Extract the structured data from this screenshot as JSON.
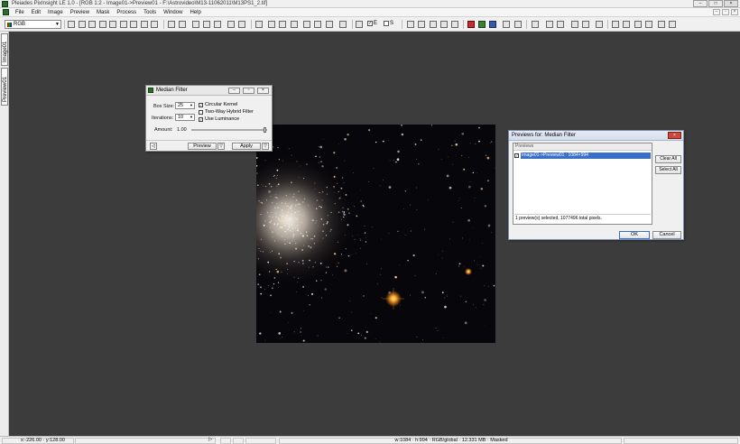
{
  "window": {
    "title": "Pleiades PixInsight LE 1.0 - [RGB 1:2 - Image01->Preview01 - F:\\Astrovideo\\M13-11062011\\M13PS1_2.tif]"
  },
  "menu": [
    "File",
    "Edit",
    "Image",
    "Preview",
    "Mask",
    "Process",
    "Tools",
    "Window",
    "Help"
  ],
  "toolbar": {
    "color_mode": "RGB",
    "check_e": "E",
    "check_s": "S"
  },
  "sidebar": {
    "tab1": "Image01",
    "tab2": "Preview01"
  },
  "median_filter": {
    "title": "Median Filter",
    "box_size_label": "Box Size:",
    "box_size_value": "25",
    "iterations_label": "Iterations:",
    "iterations_value": "10",
    "circular_kernel": "Circular Kernel",
    "two_way_hybrid": "Two-Way Hybrid Filter",
    "use_luminance": "Use Luminance",
    "amount_label": "Amount:",
    "amount_value": "1.00",
    "preview_label": "Preview",
    "apply_label": "Apply"
  },
  "previews": {
    "title": "Previews for: Median Filter",
    "header": "Previews",
    "item": "Image01->Preview01 : 1084×994",
    "status": "1 preview(s) selected, 1077496 total pixels.",
    "clear_all": "Clear All",
    "select_all": "Select All",
    "ok": "OK",
    "cancel": "Cancel"
  },
  "statusbar": {
    "coords": "x:-226.00 · y:128.00",
    "info": "w:1084 · h:994 · RGB/global · 12.331 MB · Masked"
  }
}
